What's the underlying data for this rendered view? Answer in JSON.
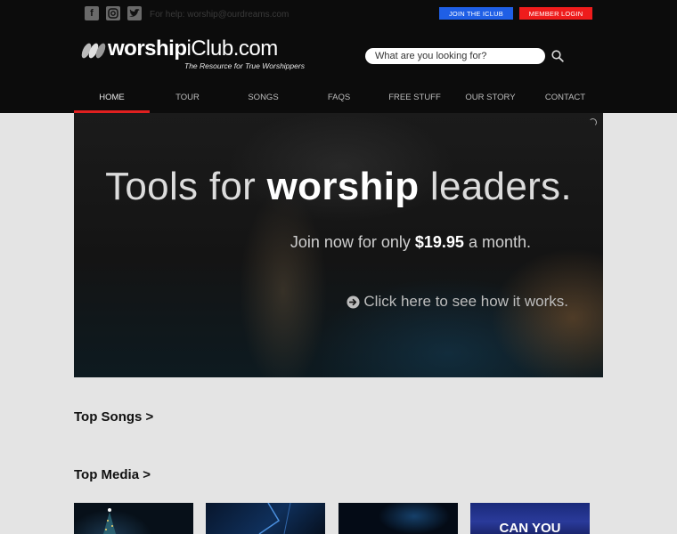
{
  "topbar": {
    "social": [
      "facebook-icon",
      "instagram-icon",
      "twitter-icon"
    ],
    "email": "For help: worship@ourdreams.com",
    "join_label": "JOIN THE ICLUB",
    "login_label": "MEMBER LOGIN"
  },
  "brand": {
    "name_bold": "worship",
    "name_rest": "iClub.com",
    "tagline": "The Resource for True Worshippers"
  },
  "search": {
    "placeholder": "What are you looking for?"
  },
  "nav": {
    "items": [
      "HOME",
      "TOUR",
      "SONGS",
      "FAQS",
      "FREE STUFF",
      "OUR STORY",
      "CONTACT"
    ],
    "active": "HOME"
  },
  "hero": {
    "title_pre": "Tools for ",
    "title_bold": "worship",
    "title_post": " leaders.",
    "sub_pre": "Join now for only ",
    "sub_price": "$19.95",
    "sub_post": " a month.",
    "cta": "Click here to see how it works."
  },
  "sections": {
    "top_songs": "Top Songs >",
    "top_media": "Top Media >"
  },
  "media": {
    "thumb4_text": "CAN YOU"
  },
  "colors": {
    "join_bg": "#1f5fe6",
    "login_bg": "#ef1c1c",
    "nav_active": "#e02020"
  }
}
